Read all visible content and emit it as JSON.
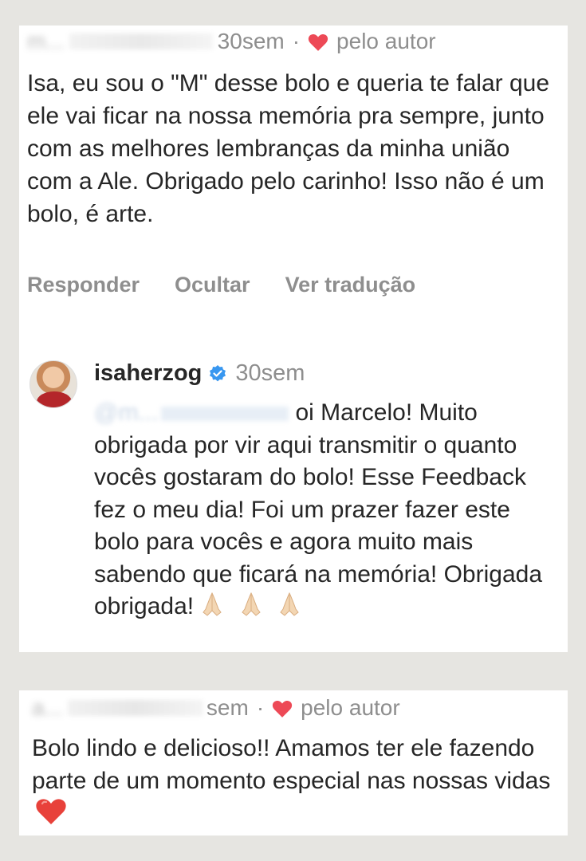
{
  "comment1": {
    "username": "m...",
    "time": "30sem",
    "separator": "·",
    "liked_by": "pelo autor",
    "text": "Isa, eu sou o \"M\" desse bolo e queria te falar que ele vai ficar na nossa memória pra sempre, junto com as melhores lembranças da minha união com a Ale. Obrigado pelo carinho! Isso não é um bolo, é arte.",
    "actions": [
      "Responder",
      "Ocultar",
      "Ver tradução"
    ]
  },
  "reply": {
    "username": "isaherzog",
    "time": "30sem",
    "mention": "@m...",
    "text": "oi Marcelo! Muito obrigada por vir aqui transmitir o quanto vocês gostaram do bolo! Esse Feedback fez o meu dia! Foi um prazer fazer este bolo para vocês e agora muito mais sabendo que ficará na memória! Obrigada obrigada!",
    "emoji_icon": "praying-hands-icon"
  },
  "comment2": {
    "username": "a...",
    "time": "sem",
    "separator": "·",
    "liked_by": "pelo autor",
    "text": "Bolo lindo e delicioso!! Amamos ter ele fazendo parte de um momento especial nas nossas vidas",
    "emoji_icon": "red-heart-icon"
  },
  "colors": {
    "heart": "#ed4956",
    "verified": "#3897f0",
    "muted": "#8e8e8e",
    "text": "#262626",
    "background": "#e6e5e1"
  }
}
